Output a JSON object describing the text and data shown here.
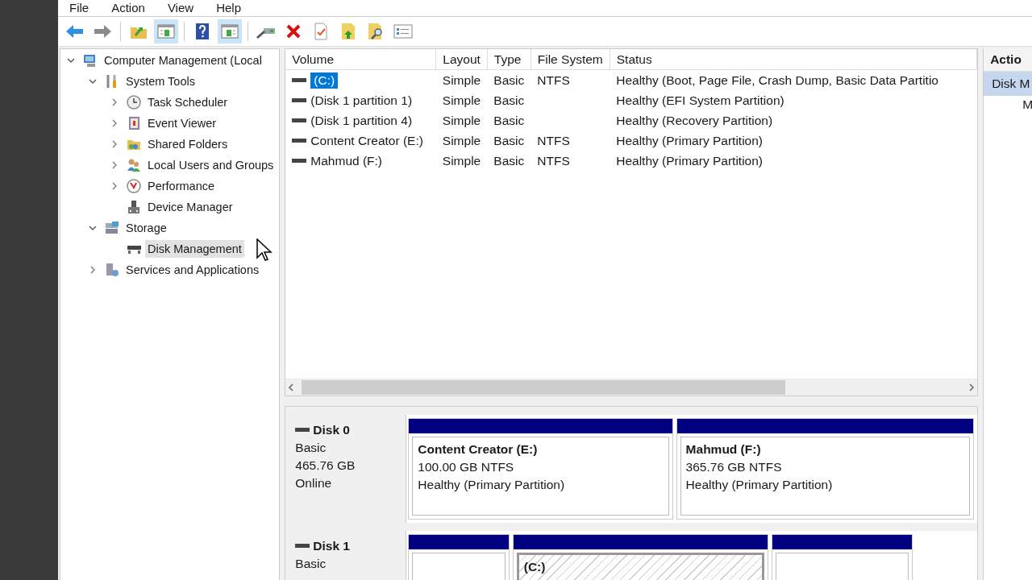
{
  "menu": [
    "File",
    "Action",
    "View",
    "Help"
  ],
  "toolbar": [
    {
      "kind": "back",
      "pressed": false
    },
    {
      "kind": "forward",
      "pressed": false
    },
    {
      "kind": "up",
      "pressed": false
    },
    {
      "kind": "tree",
      "pressed": true
    },
    {
      "kind": "help",
      "pressed": false
    },
    {
      "kind": "pane",
      "pressed": true
    },
    {
      "kind": "connect",
      "pressed": false
    },
    {
      "kind": "delete",
      "pressed": false
    },
    {
      "kind": "properties",
      "pressed": false
    },
    {
      "kind": "export",
      "pressed": false
    },
    {
      "kind": "find",
      "pressed": false
    },
    {
      "kind": "list",
      "pressed": false
    }
  ],
  "tree": [
    {
      "label": "Computer Management (Local",
      "kind": "computer",
      "selected": false,
      "expanded": true,
      "children": [
        {
          "label": "System Tools",
          "kind": "tools",
          "selected": false,
          "expanded": true,
          "children": [
            {
              "label": "Task Scheduler",
              "kind": "clock",
              "selected": false,
              "expanded": false
            },
            {
              "label": "Event Viewer",
              "kind": "log",
              "selected": false,
              "expanded": false
            },
            {
              "label": "Shared Folders",
              "kind": "folder",
              "selected": false,
              "expanded": false
            },
            {
              "label": "Local Users and Groups",
              "kind": "users",
              "selected": false,
              "expanded": false
            },
            {
              "label": "Performance",
              "kind": "gauge",
              "selected": false,
              "expanded": false
            },
            {
              "label": "Device Manager",
              "kind": "device",
              "selected": false
            }
          ]
        },
        {
          "label": "Storage",
          "kind": "storage",
          "selected": false,
          "expanded": true,
          "children": [
            {
              "label": "Disk Management",
              "kind": "disk",
              "selected": true
            }
          ]
        },
        {
          "label": "Services and Applications",
          "kind": "services",
          "selected": false,
          "expanded": false
        }
      ]
    }
  ],
  "table": {
    "columns": [
      "Volume",
      "Layout",
      "Type",
      "File System",
      "Status"
    ],
    "rows": [
      {
        "cells": [
          "(C:)",
          "Simple",
          "Basic",
          "NTFS",
          "Healthy (Boot, Page File, Crash Dump, Basic Data Partitio"
        ],
        "selected": true
      },
      {
        "cells": [
          "(Disk 1 partition 1)",
          "Simple",
          "Basic",
          "",
          "Healthy (EFI System Partition)"
        ],
        "selected": false
      },
      {
        "cells": [
          "(Disk 1 partition 4)",
          "Simple",
          "Basic",
          "",
          "Healthy (Recovery Partition)"
        ],
        "selected": false
      },
      {
        "cells": [
          "Content Creator (E:)",
          "Simple",
          "Basic",
          "NTFS",
          "Healthy (Primary Partition)"
        ],
        "selected": false
      },
      {
        "cells": [
          "Mahmud (F:)",
          "Simple",
          "Basic",
          "NTFS",
          "Healthy (Primary Partition)"
        ],
        "selected": false
      }
    ]
  },
  "disks": [
    {
      "name": "Disk 0",
      "details": [
        "Basic",
        "465.76 GB",
        "Online"
      ],
      "partitions": [
        {
          "name": "Content Creator  (E:)",
          "size": "100.00 GB NTFS",
          "status": "Healthy (Primary Partition)",
          "hatched": false
        },
        {
          "name": "Mahmud  (F:)",
          "size": "365.76 GB NTFS",
          "status": "Healthy (Primary Partition)",
          "hatched": false
        }
      ]
    },
    {
      "name": "Disk 1",
      "details": [
        "Basic"
      ],
      "partitions": [
        {
          "hatched": false
        },
        {
          "name": "(C:)",
          "hatched": true
        },
        {
          "hatched": false
        }
      ]
    }
  ],
  "actions": {
    "title": "Actio",
    "items": [
      {
        "label": "Disk M",
        "selected": true
      },
      {
        "label": "M",
        "selected": false
      }
    ]
  }
}
